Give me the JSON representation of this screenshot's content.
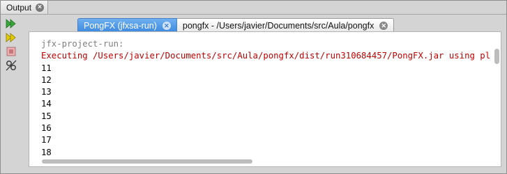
{
  "window": {
    "title": "Output",
    "close_glyph": "×"
  },
  "toolbar": [
    {
      "name": "rerun-icon",
      "color": "#3aa53a"
    },
    {
      "name": "rerun-with-params-icon",
      "color": "#d4b800"
    },
    {
      "name": "stop-icon",
      "color": "#d98b8b"
    },
    {
      "name": "settings-icon",
      "color": "#555555"
    }
  ],
  "tabs": [
    {
      "label": "PongFX (jfxsa-run)",
      "active": true
    },
    {
      "label": "pongfx - /Users/javier/Documents/src/Aula/pongfx",
      "active": false
    }
  ],
  "output": {
    "header": "jfx-project-run:",
    "executing": "Executing /Users/javier/Documents/src/Aula/pongfx/dist/run310684457/PongFX.jar using platform /Library/Java/JavaVirtualMachines/jdk1.8.0.jdk/Contents/Home/jre/bin/java",
    "numbers": [
      "11",
      "12",
      "13",
      "14",
      "15",
      "16",
      "17",
      "18"
    ],
    "colors": {
      "header": "#7f7f7f",
      "executing": "#c00000",
      "normal": "#000000"
    }
  }
}
